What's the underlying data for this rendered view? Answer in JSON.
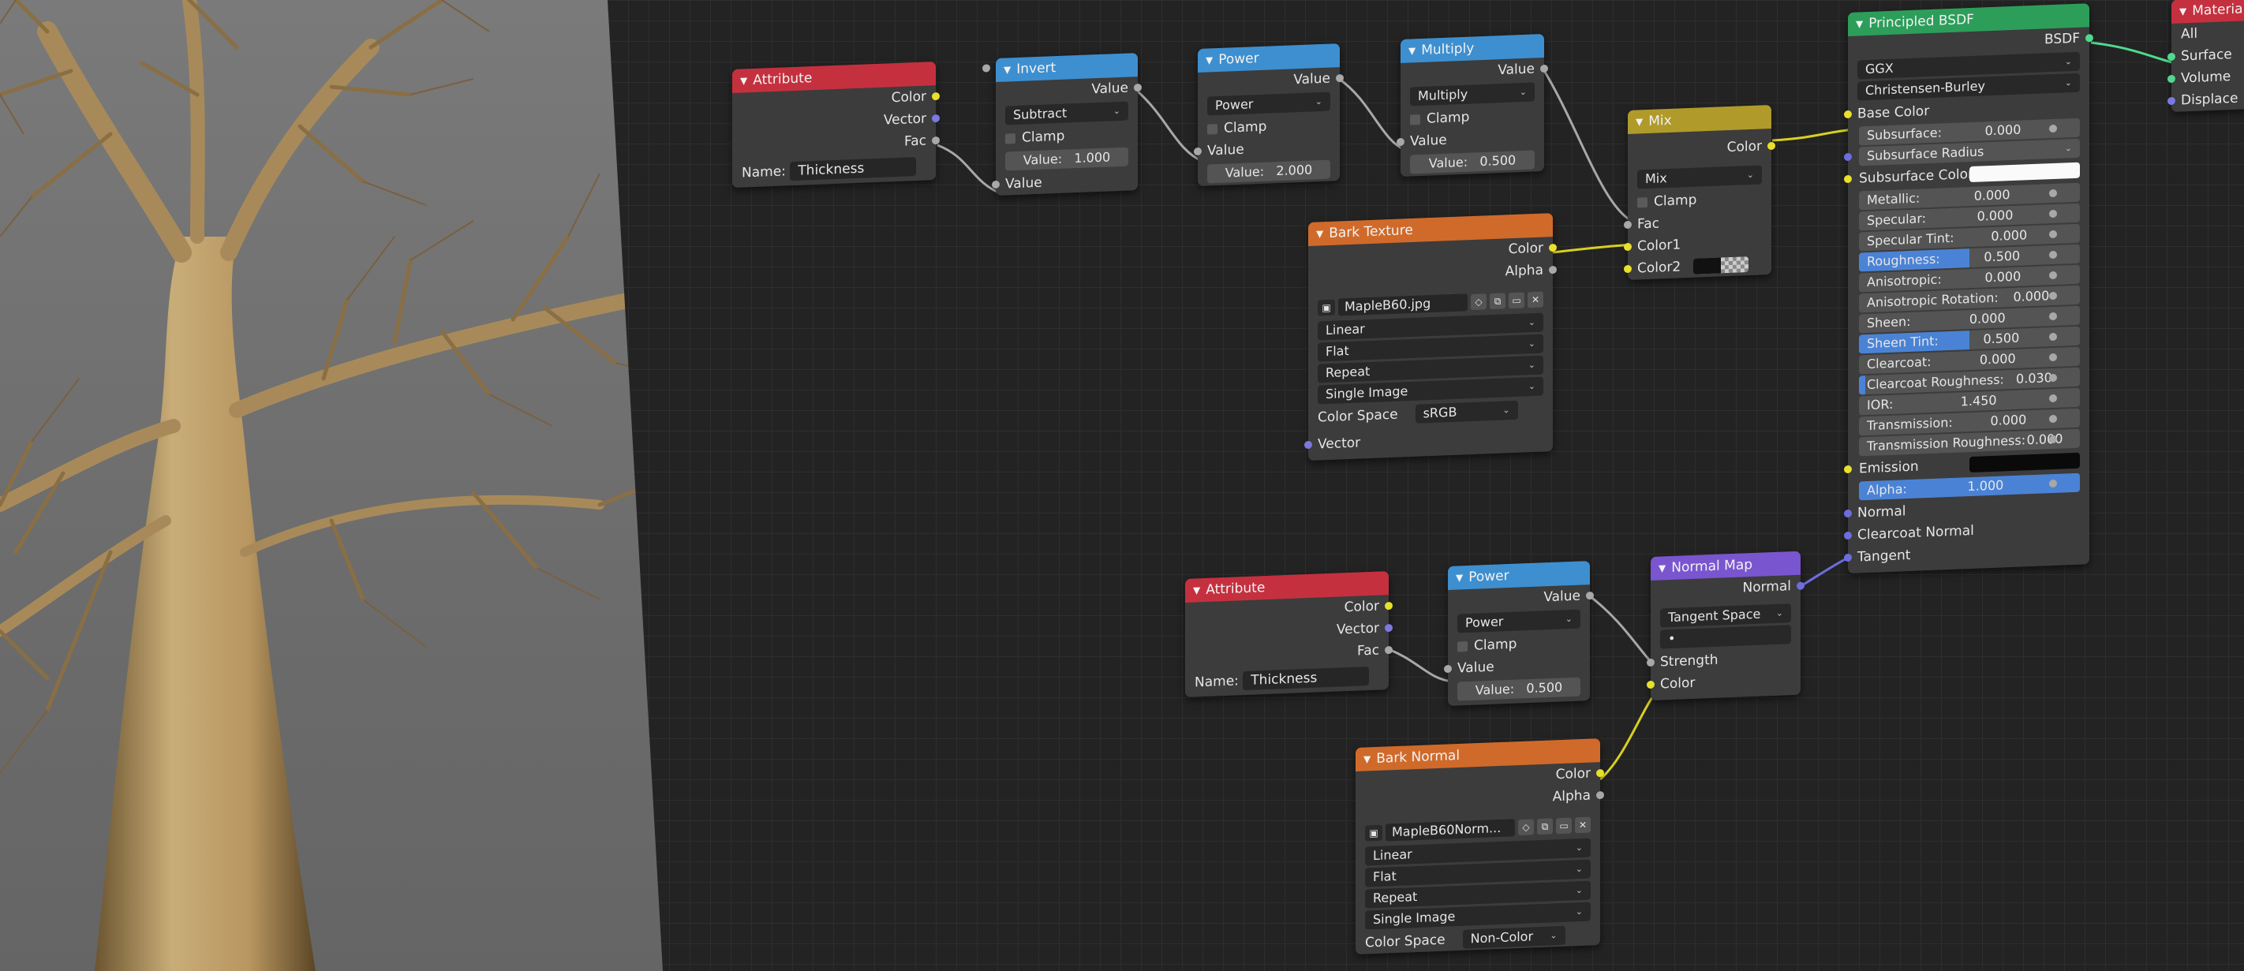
{
  "attribute1": {
    "title": "Attribute",
    "outputs": [
      "Color",
      "Vector",
      "Fac"
    ],
    "name_label": "Name:",
    "name_value": "Thickness"
  },
  "invert": {
    "title": "Invert",
    "out": "Value",
    "mode": "Subtract",
    "clamp": "Clamp",
    "value_label": "Value:",
    "value": "1.000",
    "in": "Value"
  },
  "power1": {
    "title": "Power",
    "out": "Value",
    "mode": "Power",
    "clamp": "Clamp",
    "in": "Value",
    "value_label": "Value:",
    "value": "2.000"
  },
  "multiply": {
    "title": "Multiply",
    "out": "Value",
    "mode": "Multiply",
    "clamp": "Clamp",
    "in": "Value",
    "value_label": "Value:",
    "value": "0.500"
  },
  "mix": {
    "title": "Mix",
    "out": "Color",
    "mode": "Mix",
    "clamp": "Clamp",
    "inputs": [
      "Fac",
      "Color1",
      "Color2"
    ]
  },
  "bark_texture": {
    "title": "Bark Texture",
    "outputs": [
      "Color",
      "Alpha"
    ],
    "image": "MapleB60.jpg",
    "opts": [
      "Linear",
      "Flat",
      "Repeat",
      "Single Image"
    ],
    "colorspace_label": "Color Space",
    "colorspace": "sRGB",
    "in": "Vector"
  },
  "pbsdf": {
    "title": "Principled BSDF",
    "out": "BSDF",
    "dist": "GGX",
    "sss": "Christensen-Burley",
    "base_color": "Base Color",
    "fields": [
      {
        "label": "Subsurface:",
        "value": "0.000",
        "fill": 0
      },
      {
        "label": "Subsurface Radius",
        "value": "",
        "fill": 0
      },
      {
        "label": "Subsurface Color",
        "value": "",
        "fill": 0
      },
      {
        "label": "Metallic:",
        "value": "0.000",
        "fill": 0
      },
      {
        "label": "Specular:",
        "value": "0.000",
        "fill": 0
      },
      {
        "label": "Specular Tint:",
        "value": "0.000",
        "fill": 0
      },
      {
        "label": "Roughness:",
        "value": "0.500",
        "fill": 0.5
      },
      {
        "label": "Anisotropic:",
        "value": "0.000",
        "fill": 0
      },
      {
        "label": "Anisotropic Rotation:",
        "value": "0.000",
        "fill": 0
      },
      {
        "label": "Sheen:",
        "value": "0.000",
        "fill": 0
      },
      {
        "label": "Sheen Tint:",
        "value": "0.500",
        "fill": 0.5
      },
      {
        "label": "Clearcoat:",
        "value": "0.000",
        "fill": 0
      },
      {
        "label": "Clearcoat Roughness:",
        "value": "0.030",
        "fill": 0.03
      },
      {
        "label": "IOR:",
        "value": "1.450",
        "fill": 0
      },
      {
        "label": "Transmission:",
        "value": "0.000",
        "fill": 0
      },
      {
        "label": "Transmission Roughness:",
        "value": "0.000",
        "fill": 0
      },
      {
        "label": "Emission",
        "value": "",
        "fill": 0
      },
      {
        "label": "Alpha:",
        "value": "1.000",
        "fill": 1
      }
    ],
    "tail": [
      "Normal",
      "Clearcoat Normal",
      "Tangent"
    ]
  },
  "material_output": {
    "title": "Material",
    "target": "All",
    "inputs": [
      "Surface",
      "Volume",
      "Displace"
    ]
  },
  "attribute2": {
    "title": "Attribute",
    "outputs": [
      "Color",
      "Vector",
      "Fac"
    ],
    "name_label": "Name:",
    "name_value": "Thickness"
  },
  "power2": {
    "title": "Power",
    "out": "Value",
    "mode": "Power",
    "clamp": "Clamp",
    "in": "Value",
    "value_label": "Value:",
    "value": "0.500"
  },
  "normal_map": {
    "title": "Normal Map",
    "out": "Normal",
    "space": "Tangent Space",
    "uv": "•",
    "inputs": [
      "Strength",
      "Color"
    ]
  },
  "bark_normal": {
    "title": "Bark Normal",
    "outputs": [
      "Color",
      "Alpha"
    ],
    "image": "MapleB60Norm...",
    "opts": [
      "Linear",
      "Flat",
      "Repeat",
      "Single Image"
    ],
    "colorspace_label": "Color Space",
    "colorspace": "Non-Color"
  },
  "colors": {
    "editor_bg": "#232323",
    "viewport_bg": "#6e6e6e",
    "attr_header": "#c5303f",
    "math_header": "#3d8fd0",
    "texture_header": "#d06a2a",
    "mix_header": "#b09a2a",
    "shader_header": "#2c9e5a",
    "vector_header": "#7a55d0"
  }
}
